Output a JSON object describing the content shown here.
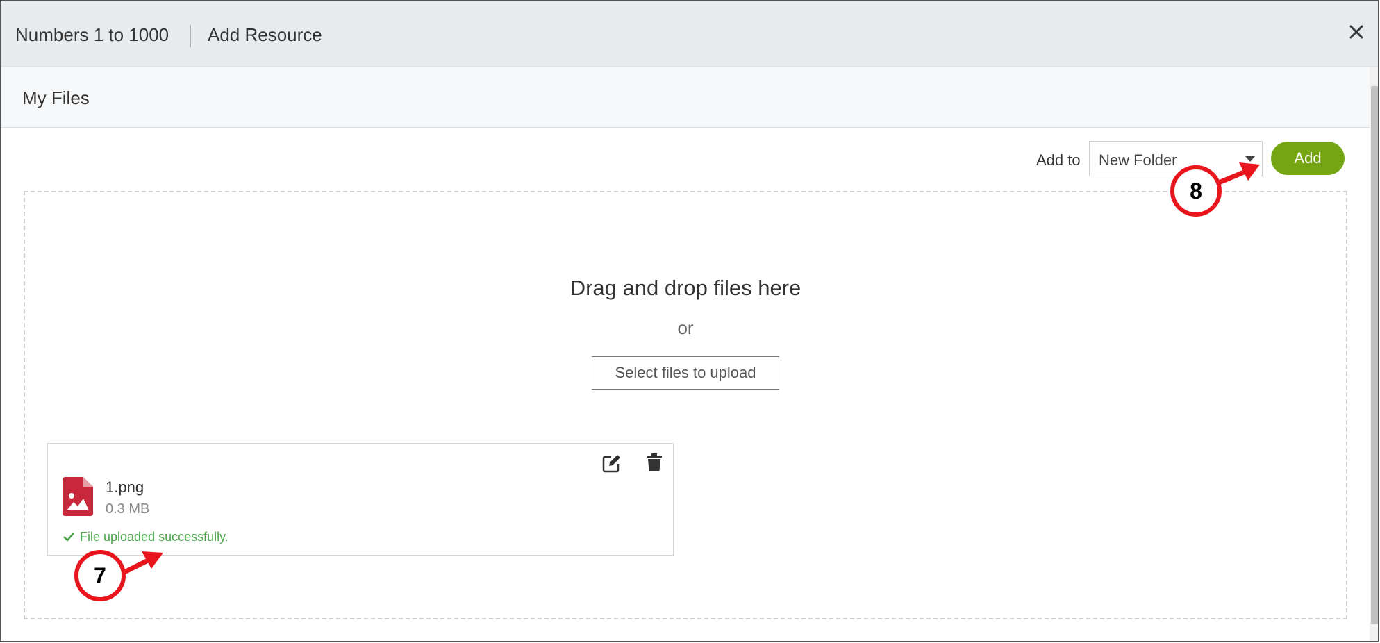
{
  "header": {
    "title": "Numbers 1 to 1000",
    "subtitle": "Add Resource"
  },
  "subheader": {
    "title": "My Files"
  },
  "toolbar": {
    "add_to_label": "Add to",
    "folder_select_value": "New Folder",
    "add_button_label": "Add"
  },
  "dropzone": {
    "title": "Drag and drop files here",
    "or_text": "or",
    "select_button_label": "Select files to upload"
  },
  "file": {
    "name": "1.png",
    "size": "0.3 MB",
    "status": "File uploaded successfully."
  },
  "callouts": {
    "upload_step": "7",
    "add_step": "8"
  },
  "colors": {
    "accent_green": "#75a513",
    "success_green": "#4aa54a",
    "file_icon_red": "#c8283c",
    "callout_red": "#e8151c"
  },
  "icons": {
    "close": "close-icon",
    "caret": "caret-down-icon",
    "file_type": "image-file-icon",
    "edit": "edit-icon",
    "delete": "trash-icon",
    "status": "check-icon"
  }
}
